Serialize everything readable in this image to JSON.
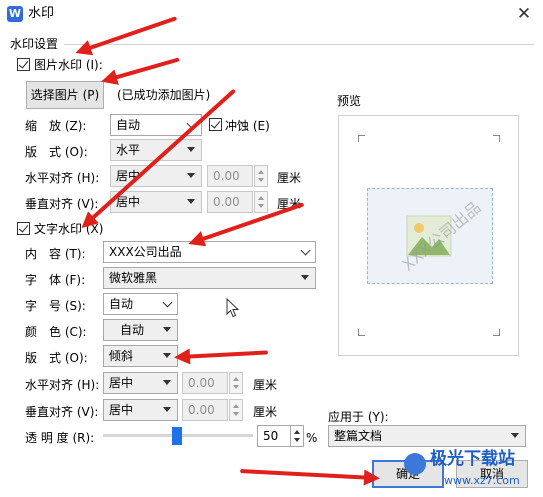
{
  "window": {
    "title": "水印",
    "app_icon_letter": "W"
  },
  "group_title": "水印设置",
  "picture": {
    "checkbox_label": "图片水印 (I):",
    "checked": true,
    "select_button": "选择图片 (P)",
    "status": "(已成功添加图片)",
    "scale_label": "缩　放 (Z):",
    "scale_value": "自动",
    "washout_label": "冲蚀 (E)",
    "washout_checked": true,
    "layout_label": "版　式 (O):",
    "layout_value": "水平",
    "halign_label": "水平对齐 (H):",
    "halign_value": "居中",
    "halign_offset": "0.00",
    "valign_label": "垂直对齐 (V):",
    "valign_value": "居中",
    "valign_offset": "0.00",
    "unit": "厘米"
  },
  "text": {
    "checkbox_label": "文字水印 (X)",
    "checked": true,
    "content_label": "内　容 (T):",
    "content_value": "XXX公司出品",
    "font_label": "字　体 (F):",
    "font_value": "微软雅黑",
    "size_label": "字　号 (S):",
    "size_value": "自动",
    "color_label": "颜　色 (C):",
    "color_value": "自动",
    "layout_label": "版　式 (O):",
    "layout_value": "倾斜",
    "halign_label": "水平对齐 (H):",
    "halign_value": "居中",
    "halign_offset": "0.00",
    "valign_label": "垂直对齐 (V):",
    "valign_value": "居中",
    "valign_offset": "0.00",
    "unit": "厘米",
    "transparency_label": "透 明 度 (R):",
    "transparency_value": "50",
    "transparency_fraction": 0.5,
    "percent": "%"
  },
  "preview": {
    "label": "预览",
    "watermark_text": "XXX公司出品"
  },
  "apply": {
    "label": "应用于 (Y):",
    "value": "整篇文档"
  },
  "buttons": {
    "ok": "确定",
    "cancel": "取消"
  },
  "site_watermark": {
    "name": "极光下载站",
    "url": "www.xz7.com"
  },
  "colors": {
    "accent": "#e0201a",
    "app_icon": "#2f6bd9",
    "highlight": "#3c78d8"
  }
}
